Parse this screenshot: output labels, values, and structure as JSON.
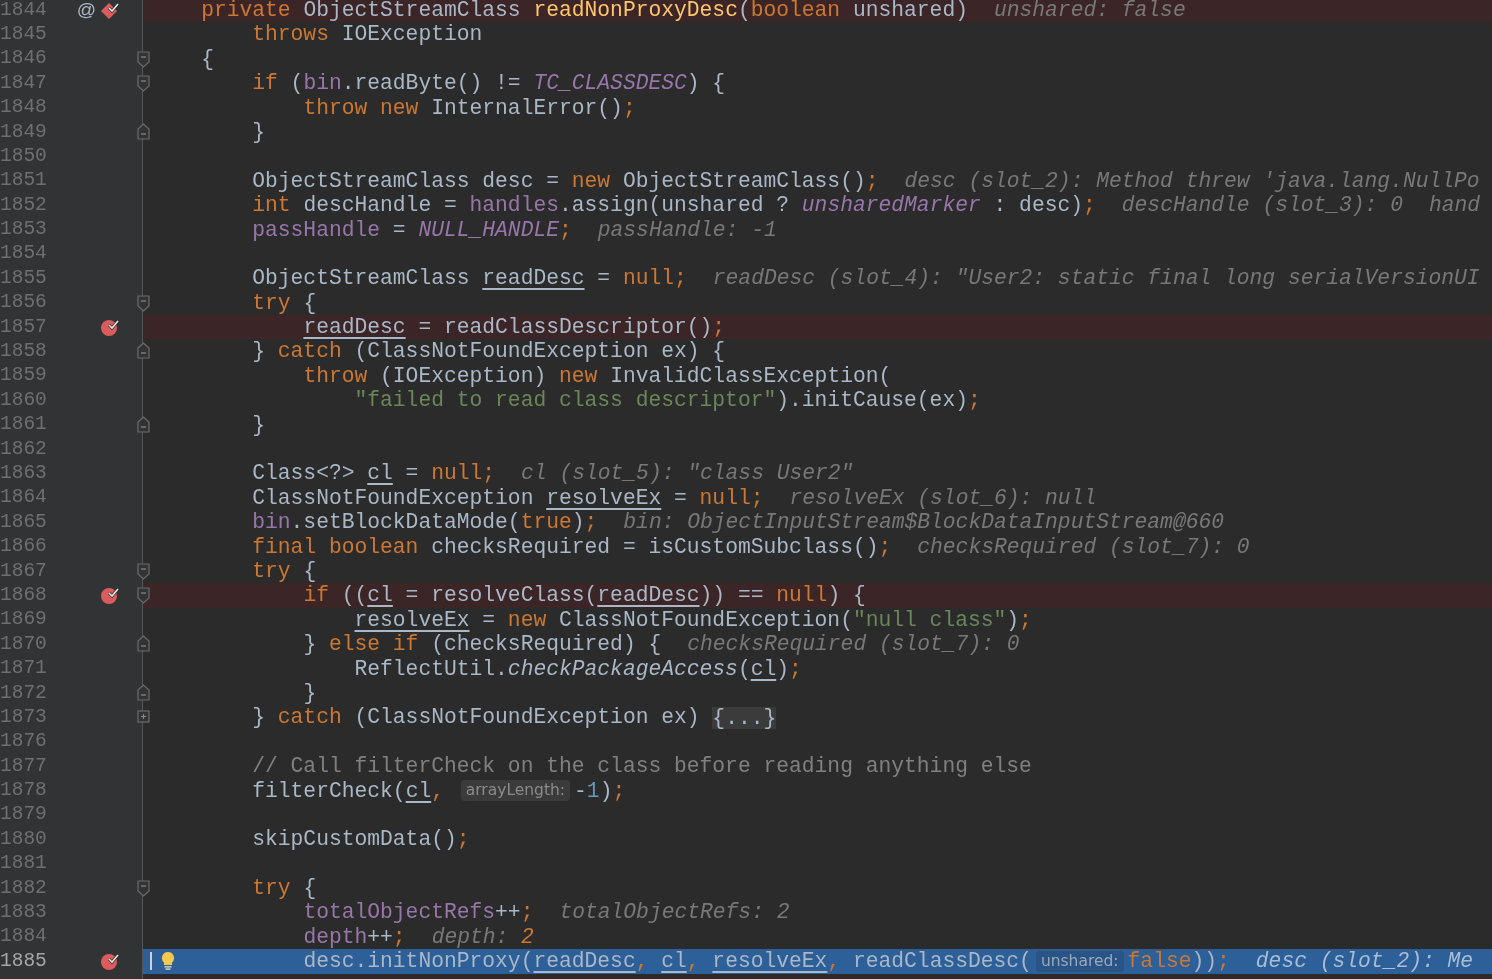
{
  "editor": {
    "lines": [
      {
        "number": "1844",
        "kind": "breakpoint",
        "annotation": "@",
        "gutter_icon": {
          "kind": "method-breakpoint"
        },
        "segments": [
          {
            "kind": "code",
            "tokens": [
              {
                "kind": "k",
                "text": "    private "
              },
              {
                "kind": "p",
                "text": "ObjectStreamClass "
              },
              {
                "kind": "m",
                "text": "readNonProxyDesc"
              },
              {
                "kind": "p",
                "text": "("
              },
              {
                "kind": "k",
                "text": "boolean "
              },
              {
                "kind": "p",
                "text": "unshared)"
              }
            ]
          },
          {
            "kind": "debug",
            "tokens": [
              {
                "kind": "d",
                "text": "unshared: false"
              }
            ]
          }
        ]
      },
      {
        "number": "1845",
        "kind": "normal",
        "segments": [
          {
            "kind": "code",
            "tokens": [
              {
                "kind": "k",
                "text": "        throws "
              },
              {
                "kind": "p",
                "text": "IOException"
              }
            ]
          }
        ]
      },
      {
        "number": "1846",
        "kind": "normal",
        "fold_marker": {
          "kind": "start"
        },
        "segments": [
          {
            "kind": "code",
            "tokens": [
              {
                "kind": "p",
                "text": "    {"
              }
            ]
          }
        ]
      },
      {
        "number": "1847",
        "kind": "normal",
        "fold_marker": {
          "kind": "start"
        },
        "segments": [
          {
            "kind": "code",
            "tokens": [
              {
                "kind": "k",
                "text": "        if "
              },
              {
                "kind": "p",
                "text": "("
              },
              {
                "kind": "f",
                "text": "bin"
              },
              {
                "kind": "p",
                "text": ".readByte() != "
              },
              {
                "kind": "c",
                "text": "TC_CLASSDESC"
              },
              {
                "kind": "p",
                "text": ") {"
              }
            ]
          }
        ]
      },
      {
        "number": "1848",
        "kind": "normal",
        "segments": [
          {
            "kind": "code",
            "tokens": [
              {
                "kind": "k",
                "text": "            throw new "
              },
              {
                "kind": "p",
                "text": "InternalError()"
              },
              {
                "kind": "k",
                "text": ";"
              }
            ]
          }
        ]
      },
      {
        "number": "1849",
        "kind": "normal",
        "fold_marker": {
          "kind": "end"
        },
        "segments": [
          {
            "kind": "code",
            "tokens": [
              {
                "kind": "p",
                "text": "        }"
              }
            ]
          }
        ]
      },
      {
        "number": "1850",
        "kind": "normal"
      },
      {
        "number": "1851",
        "kind": "normal",
        "segments": [
          {
            "kind": "code",
            "tokens": [
              {
                "kind": "p",
                "text": "        ObjectStreamClass desc = "
              },
              {
                "kind": "k",
                "text": "new "
              },
              {
                "kind": "p",
                "text": "ObjectStreamClass()"
              },
              {
                "kind": "k",
                "text": ";"
              }
            ]
          },
          {
            "kind": "debug",
            "tokens": [
              {
                "kind": "d",
                "text": "desc (slot_2): Method threw 'java.lang.NullPo"
              }
            ]
          }
        ]
      },
      {
        "number": "1852",
        "kind": "normal",
        "segments": [
          {
            "kind": "code",
            "tokens": [
              {
                "kind": "k",
                "text": "        int "
              },
              {
                "kind": "p",
                "text": "descHandle = "
              },
              {
                "kind": "f",
                "text": "handles"
              },
              {
                "kind": "p",
                "text": ".assign(unshared ? "
              },
              {
                "kind": "c",
                "text": "unsharedMarker"
              },
              {
                "kind": "p",
                "text": " : desc)"
              },
              {
                "kind": "k",
                "text": ";"
              }
            ]
          },
          {
            "kind": "debug",
            "tokens": [
              {
                "kind": "d",
                "text": "descHandle (slot_3): 0"
              }
            ]
          },
          {
            "kind": "debug",
            "tokens": [
              {
                "kind": "d",
                "text": "hand"
              }
            ]
          }
        ]
      },
      {
        "number": "1853",
        "kind": "normal",
        "segments": [
          {
            "kind": "code",
            "tokens": [
              {
                "kind": "f",
                "text": "        passHandle"
              },
              {
                "kind": "p",
                "text": " = "
              },
              {
                "kind": "c",
                "text": "NULL_HANDLE"
              },
              {
                "kind": "k",
                "text": ";"
              }
            ]
          },
          {
            "kind": "debug",
            "tokens": [
              {
                "kind": "d",
                "text": "passHandle: -1"
              }
            ]
          }
        ]
      },
      {
        "number": "1854",
        "kind": "normal"
      },
      {
        "number": "1855",
        "kind": "normal",
        "segments": [
          {
            "kind": "code",
            "tokens": [
              {
                "kind": "p",
                "text": "        ObjectStreamClass "
              },
              {
                "kind": "u",
                "text": "readDesc"
              },
              {
                "kind": "p",
                "text": " = "
              },
              {
                "kind": "k",
                "text": "null;"
              }
            ]
          },
          {
            "kind": "debug",
            "tokens": [
              {
                "kind": "d",
                "text": "readDesc (slot_4): \"User2: static final long serialVersionUI"
              }
            ]
          }
        ]
      },
      {
        "number": "1856",
        "kind": "normal",
        "fold_marker": {
          "kind": "start"
        },
        "segments": [
          {
            "kind": "code",
            "tokens": [
              {
                "kind": "k",
                "text": "        try "
              },
              {
                "kind": "p",
                "text": "{"
              }
            ]
          }
        ]
      },
      {
        "number": "1857",
        "kind": "breakpoint",
        "gutter_icon": {
          "kind": "breakpoint"
        },
        "segments": [
          {
            "kind": "code",
            "tokens": [
              {
                "kind": "u",
                "text": "            readDesc"
              },
              {
                "kind": "p",
                "text": " = readClassDescriptor()"
              },
              {
                "kind": "k",
                "text": ";"
              }
            ]
          }
        ]
      },
      {
        "number": "1858",
        "kind": "normal",
        "fold_marker": {
          "kind": "end"
        },
        "segments": [
          {
            "kind": "code",
            "tokens": [
              {
                "kind": "p",
                "text": "        } "
              },
              {
                "kind": "k",
                "text": "catch "
              },
              {
                "kind": "p",
                "text": "(ClassNotFoundException ex) {"
              }
            ]
          }
        ]
      },
      {
        "number": "1859",
        "kind": "normal",
        "segments": [
          {
            "kind": "code",
            "tokens": [
              {
                "kind": "k",
                "text": "            throw "
              },
              {
                "kind": "p",
                "text": "(IOException) "
              },
              {
                "kind": "k",
                "text": "new "
              },
              {
                "kind": "p",
                "text": "InvalidClassException("
              }
            ]
          }
        ]
      },
      {
        "number": "1860",
        "kind": "normal",
        "segments": [
          {
            "kind": "code",
            "tokens": [
              {
                "kind": "s",
                "text": "                \"failed to read class descriptor\""
              },
              {
                "kind": "p",
                "text": ").initCause(ex)"
              },
              {
                "kind": "k",
                "text": ";"
              }
            ]
          }
        ]
      },
      {
        "number": "1861",
        "kind": "normal",
        "fold_marker": {
          "kind": "end"
        },
        "segments": [
          {
            "kind": "code",
            "tokens": [
              {
                "kind": "p",
                "text": "        }"
              }
            ]
          }
        ]
      },
      {
        "number": "1862",
        "kind": "normal"
      },
      {
        "number": "1863",
        "kind": "normal",
        "segments": [
          {
            "kind": "code",
            "tokens": [
              {
                "kind": "p",
                "text": "        Class<?> "
              },
              {
                "kind": "u",
                "text": "cl"
              },
              {
                "kind": "p",
                "text": " = "
              },
              {
                "kind": "k",
                "text": "null;"
              }
            ]
          },
          {
            "kind": "debug",
            "tokens": [
              {
                "kind": "d",
                "text": "cl (slot_5): \"class User2\""
              }
            ]
          }
        ]
      },
      {
        "number": "1864",
        "kind": "normal",
        "segments": [
          {
            "kind": "code",
            "tokens": [
              {
                "kind": "p",
                "text": "        ClassNotFoundException "
              },
              {
                "kind": "u",
                "text": "resolveEx"
              },
              {
                "kind": "p",
                "text": " = "
              },
              {
                "kind": "k",
                "text": "null;"
              }
            ]
          },
          {
            "kind": "debug",
            "tokens": [
              {
                "kind": "d",
                "text": "resolveEx (slot_6): null"
              }
            ]
          }
        ]
      },
      {
        "number": "1865",
        "kind": "normal",
        "segments": [
          {
            "kind": "code",
            "tokens": [
              {
                "kind": "f",
                "text": "        bin"
              },
              {
                "kind": "p",
                "text": ".setBlockDataMode("
              },
              {
                "kind": "k",
                "text": "true"
              },
              {
                "kind": "p",
                "text": ")"
              },
              {
                "kind": "k",
                "text": ";"
              }
            ]
          },
          {
            "kind": "debug",
            "tokens": [
              {
                "kind": "d",
                "text": "bin: ObjectInputStream$BlockDataInputStream@660"
              }
            ]
          }
        ]
      },
      {
        "number": "1866",
        "kind": "normal",
        "segments": [
          {
            "kind": "code",
            "tokens": [
              {
                "kind": "k",
                "text": "        final boolean "
              },
              {
                "kind": "p",
                "text": "checksRequired = isCustomSubclass()"
              },
              {
                "kind": "k",
                "text": ";"
              }
            ]
          },
          {
            "kind": "debug",
            "tokens": [
              {
                "kind": "d",
                "text": "checksRequired (slot_7): 0"
              }
            ]
          }
        ]
      },
      {
        "number": "1867",
        "kind": "normal",
        "fold_marker": {
          "kind": "start"
        },
        "segments": [
          {
            "kind": "code",
            "tokens": [
              {
                "kind": "k",
                "text": "        try "
              },
              {
                "kind": "p",
                "text": "{"
              }
            ]
          }
        ]
      },
      {
        "number": "1868",
        "kind": "breakpoint",
        "gutter_icon": {
          "kind": "breakpoint"
        },
        "fold_marker": {
          "kind": "start"
        },
        "segments": [
          {
            "kind": "code",
            "tokens": [
              {
                "kind": "k",
                "text": "            if "
              },
              {
                "kind": "p",
                "text": "(("
              },
              {
                "kind": "u",
                "text": "cl"
              },
              {
                "kind": "p",
                "text": " = resolveClass("
              },
              {
                "kind": "u",
                "text": "readDesc"
              },
              {
                "kind": "p",
                "text": ")) == "
              },
              {
                "kind": "k",
                "text": "null"
              },
              {
                "kind": "p",
                "text": ") {"
              }
            ]
          }
        ]
      },
      {
        "number": "1869",
        "kind": "normal",
        "segments": [
          {
            "kind": "code",
            "tokens": [
              {
                "kind": "u",
                "text": "                resolveEx"
              },
              {
                "kind": "p",
                "text": " = "
              },
              {
                "kind": "k",
                "text": "new "
              },
              {
                "kind": "p",
                "text": "ClassNotFoundException("
              },
              {
                "kind": "s",
                "text": "\"null class\""
              },
              {
                "kind": "p",
                "text": ")"
              },
              {
                "kind": "k",
                "text": ";"
              }
            ]
          }
        ]
      },
      {
        "number": "1870",
        "kind": "normal",
        "fold_marker": {
          "kind": "end"
        },
        "segments": [
          {
            "kind": "code",
            "tokens": [
              {
                "kind": "p",
                "text": "            } "
              },
              {
                "kind": "k",
                "text": "else if "
              },
              {
                "kind": "p",
                "text": "(checksRequired) {"
              }
            ]
          },
          {
            "kind": "debug",
            "tokens": [
              {
                "kind": "d",
                "text": "checksRequired (slot_7): 0"
              }
            ]
          }
        ]
      },
      {
        "number": "1871",
        "kind": "normal",
        "segments": [
          {
            "kind": "code",
            "tokens": [
              {
                "kind": "p",
                "text": "                ReflectUtil."
              },
              {
                "kind": "i",
                "text": "checkPackageAccess"
              },
              {
                "kind": "p",
                "text": "("
              },
              {
                "kind": "u",
                "text": "cl"
              },
              {
                "kind": "p",
                "text": ")"
              },
              {
                "kind": "k",
                "text": ";"
              }
            ]
          }
        ]
      },
      {
        "number": "1872",
        "kind": "normal",
        "fold_marker": {
          "kind": "end"
        },
        "segments": [
          {
            "kind": "code",
            "tokens": [
              {
                "kind": "p",
                "text": "            }"
              }
            ]
          }
        ]
      },
      {
        "number": "1873",
        "kind": "normal",
        "fold_marker": {
          "kind": "collapsed"
        },
        "segments": [
          {
            "kind": "code",
            "tokens": [
              {
                "kind": "p",
                "text": "        } "
              },
              {
                "kind": "k",
                "text": "catch "
              },
              {
                "kind": "p",
                "text": "(ClassNotFoundException ex) "
              }
            ]
          },
          {
            "kind": "folded",
            "text": "{...}"
          }
        ]
      },
      {
        "number": "1876",
        "kind": "normal"
      },
      {
        "number": "1877",
        "kind": "normal",
        "segments": [
          {
            "kind": "code",
            "tokens": [
              {
                "kind": "cm",
                "text": "        // Call filterCheck on the class before reading anything else"
              }
            ]
          }
        ]
      },
      {
        "number": "1878",
        "kind": "normal",
        "segments": [
          {
            "kind": "code",
            "tokens": [
              {
                "kind": "p",
                "text": "        filterCheck("
              },
              {
                "kind": "u",
                "text": "cl"
              },
              {
                "kind": "k",
                "text": ", "
              }
            ]
          },
          {
            "kind": "hint",
            "text": "arrayLength:"
          },
          {
            "kind": "code",
            "tokens": [
              {
                "kind": "p",
                "text": "-"
              },
              {
                "kind": "n",
                "text": "1"
              },
              {
                "kind": "p",
                "text": ")"
              },
              {
                "kind": "k",
                "text": ";"
              }
            ]
          }
        ]
      },
      {
        "number": "1879",
        "kind": "normal"
      },
      {
        "number": "1880",
        "kind": "normal",
        "segments": [
          {
            "kind": "code",
            "tokens": [
              {
                "kind": "p",
                "text": "        skipCustomData()"
              },
              {
                "kind": "k",
                "text": ";"
              }
            ]
          }
        ]
      },
      {
        "number": "1881",
        "kind": "normal"
      },
      {
        "number": "1882",
        "kind": "normal",
        "fold_marker": {
          "kind": "start"
        },
        "segments": [
          {
            "kind": "code",
            "tokens": [
              {
                "kind": "k",
                "text": "        try "
              },
              {
                "kind": "p",
                "text": "{"
              }
            ]
          }
        ]
      },
      {
        "number": "1883",
        "kind": "normal",
        "segments": [
          {
            "kind": "code",
            "tokens": [
              {
                "kind": "f",
                "text": "            totalObjectRefs"
              },
              {
                "kind": "p",
                "text": "++"
              },
              {
                "kind": "k",
                "text": ";"
              }
            ]
          },
          {
            "kind": "debug",
            "tokens": [
              {
                "kind": "d",
                "text": "totalObjectRefs: 2"
              }
            ]
          }
        ]
      },
      {
        "number": "1884",
        "kind": "normal",
        "segments": [
          {
            "kind": "code",
            "tokens": [
              {
                "kind": "f",
                "text": "            depth"
              },
              {
                "kind": "p",
                "text": "++"
              },
              {
                "kind": "k",
                "text": ";"
              }
            ]
          },
          {
            "kind": "debug",
            "tokens": [
              {
                "kind": "d",
                "text": "depth: "
              },
              {
                "kind": "dv",
                "text": "2"
              }
            ]
          }
        ]
      },
      {
        "number": "1885",
        "kind": "execution",
        "gutter_icon": {
          "kind": "breakpoint"
        },
        "segments": [
          {
            "kind": "code",
            "tokens": [
              {
                "kind": "p",
                "text": "            desc.initNonProxy("
              },
              {
                "kind": "u",
                "text": "readDesc"
              },
              {
                "kind": "k",
                "text": ", "
              },
              {
                "kind": "u",
                "text": "cl"
              },
              {
                "kind": "k",
                "text": ", "
              },
              {
                "kind": "u",
                "text": "resolveEx"
              },
              {
                "kind": "k",
                "text": ", "
              },
              {
                "kind": "p",
                "text": "readClassDesc("
              }
            ]
          },
          {
            "kind": "hint",
            "text": "unshared:"
          },
          {
            "kind": "code",
            "tokens": [
              {
                "kind": "k",
                "text": "false"
              },
              {
                "kind": "p",
                "text": "))"
              },
              {
                "kind": "k",
                "text": ";"
              }
            ]
          },
          {
            "kind": "debug",
            "tokens": [
              {
                "kind": "d",
                "text": "desc (slot_2): Me"
              }
            ]
          }
        ]
      }
    ]
  }
}
